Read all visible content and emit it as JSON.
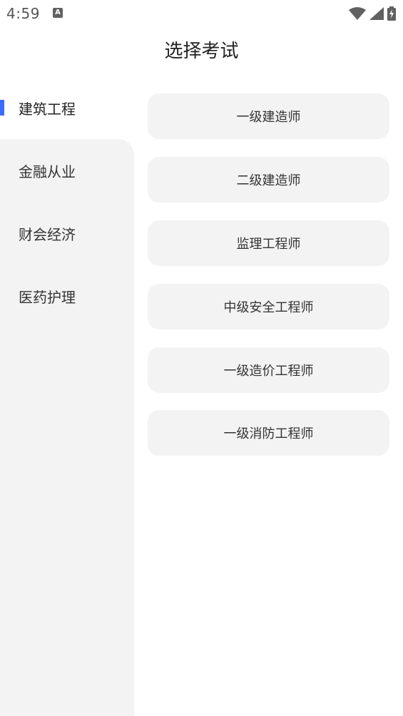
{
  "status_bar": {
    "time": "4:59",
    "a_icon_letter": "A",
    "icons": [
      "wifi-icon",
      "cellular-signal-icon",
      "battery-charging-icon"
    ]
  },
  "header": {
    "title": "选择考试"
  },
  "sidebar": {
    "accent_color": "#3d6bff",
    "selected_index": 0,
    "items": [
      {
        "label": "建筑工程"
      },
      {
        "label": "金融从业"
      },
      {
        "label": "财会经济"
      },
      {
        "label": "医药护理"
      }
    ]
  },
  "exams": [
    {
      "label": "一级建造师"
    },
    {
      "label": "二级建造师"
    },
    {
      "label": "监理工程师"
    },
    {
      "label": "中级安全工程师"
    },
    {
      "label": "一级造价工程师"
    },
    {
      "label": "一级消防工程师"
    }
  ]
}
